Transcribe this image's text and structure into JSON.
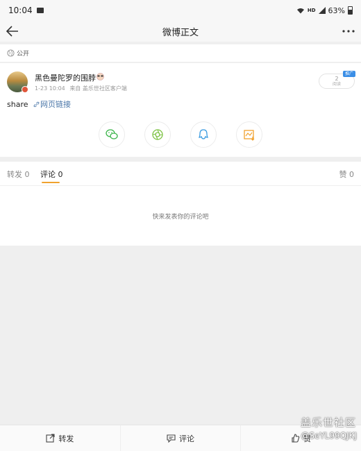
{
  "status_bar": {
    "time": "10:04",
    "battery": "63%",
    "network": "HD"
  },
  "nav": {
    "title": "微博正文"
  },
  "post": {
    "visibility": "公开",
    "username": "黑色曼陀罗的围脖",
    "date": "1-23 10:04",
    "source": "来自 盖乐世社区客户端",
    "promote_count": "2",
    "promote_sub": "阅读",
    "promote_tag": "推广",
    "text": "share",
    "link_text": "网页链接"
  },
  "share": {
    "icons": [
      "wechat-icon",
      "moments-icon",
      "qq-icon",
      "image-share-icon"
    ]
  },
  "tabs": {
    "repost": "转发 0",
    "comment": "评论 0",
    "like": "赞 0"
  },
  "comments": {
    "empty": "快来发表你的评论吧"
  },
  "bottom_bar": {
    "repost": "转发",
    "comment": "评论",
    "like": "赞"
  },
  "watermark": {
    "title": "盖乐世社区",
    "sub": "@SeYL99QJKJ"
  },
  "colors": {
    "accent": "#f0a22e",
    "link": "#4a76a8",
    "promote": "#3a8ee6",
    "wechat": "#3bb54a",
    "qq": "#3a9be0",
    "image": "#f0a22e"
  }
}
